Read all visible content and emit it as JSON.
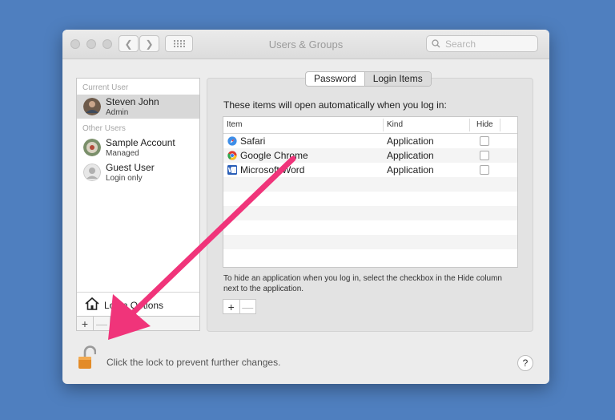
{
  "window": {
    "title": "Users & Groups"
  },
  "search": {
    "placeholder": "Search"
  },
  "sidebar": {
    "current_user_label": "Current User",
    "other_users_label": "Other Users",
    "users": [
      {
        "name": "Steven John",
        "role": "Admin"
      },
      {
        "name": "Sample Account",
        "role": "Managed"
      },
      {
        "name": "Guest User",
        "role": "Login only"
      }
    ],
    "login_options": "Login Options",
    "add_label": "+",
    "remove_label": "—"
  },
  "tabs": [
    {
      "label": "Password"
    },
    {
      "label": "Login Items"
    }
  ],
  "login_items": {
    "intro": "These items will open automatically when you log in:",
    "columns": {
      "item": "Item",
      "kind": "Kind",
      "hide": "Hide"
    },
    "rows": [
      {
        "item": "Safari",
        "kind": "Application",
        "icon": "safari-icon"
      },
      {
        "item": "Google Chrome",
        "kind": "Application",
        "icon": "chrome-icon"
      },
      {
        "item": "Microsoft Word",
        "kind": "Application",
        "icon": "word-icon"
      }
    ],
    "hint": "To hide an application when you log in, select the checkbox in the Hide column next to the application.",
    "add_label": "+",
    "remove_label": "—"
  },
  "lock": {
    "text": "Click the lock to prevent further changes."
  },
  "help": {
    "label": "?"
  },
  "colors": {
    "desktop": "#4f7fbf",
    "arrow": "#f0347a"
  }
}
